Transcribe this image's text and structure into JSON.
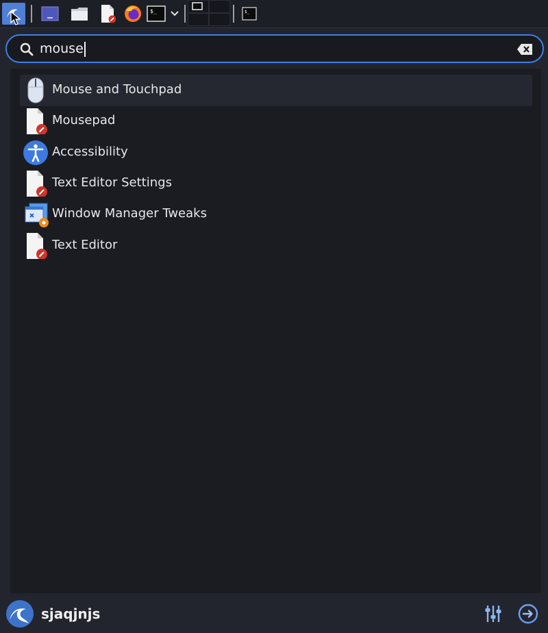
{
  "panel": {
    "launchers": [
      {
        "icon": "kali-menu-icon"
      },
      {
        "icon": "desktop-icon"
      },
      {
        "icon": "file-manager-icon"
      },
      {
        "icon": "text-editor-icon"
      },
      {
        "icon": "firefox-icon"
      },
      {
        "icon": "terminal-icon"
      },
      {
        "icon": "chevron-down-icon"
      },
      {
        "icon": "workspace-switcher-icon"
      },
      {
        "icon": "terminal-window-icon"
      }
    ]
  },
  "search": {
    "value": "mouse",
    "icon": "search-icon",
    "clear_icon": "backspace-clear-icon",
    "accent": "#3f7fe5"
  },
  "results": [
    {
      "label": "Mouse and Touchpad",
      "icon": "mouse-icon",
      "selected": true
    },
    {
      "label": "Mousepad",
      "icon": "text-editor-icon",
      "selected": false
    },
    {
      "label": "Accessibility",
      "icon": "accessibility-icon",
      "selected": false
    },
    {
      "label": "Text Editor Settings",
      "icon": "text-editor-icon",
      "selected": false
    },
    {
      "label": "Window Manager Tweaks",
      "icon": "window-tweaks-icon",
      "selected": false
    },
    {
      "label": "Text Editor",
      "icon": "text-editor-icon",
      "selected": false
    }
  ],
  "footer": {
    "username": "sjaqjnjs",
    "settings_icon": "settings-sliders-icon",
    "logout_icon": "logout-icon"
  }
}
